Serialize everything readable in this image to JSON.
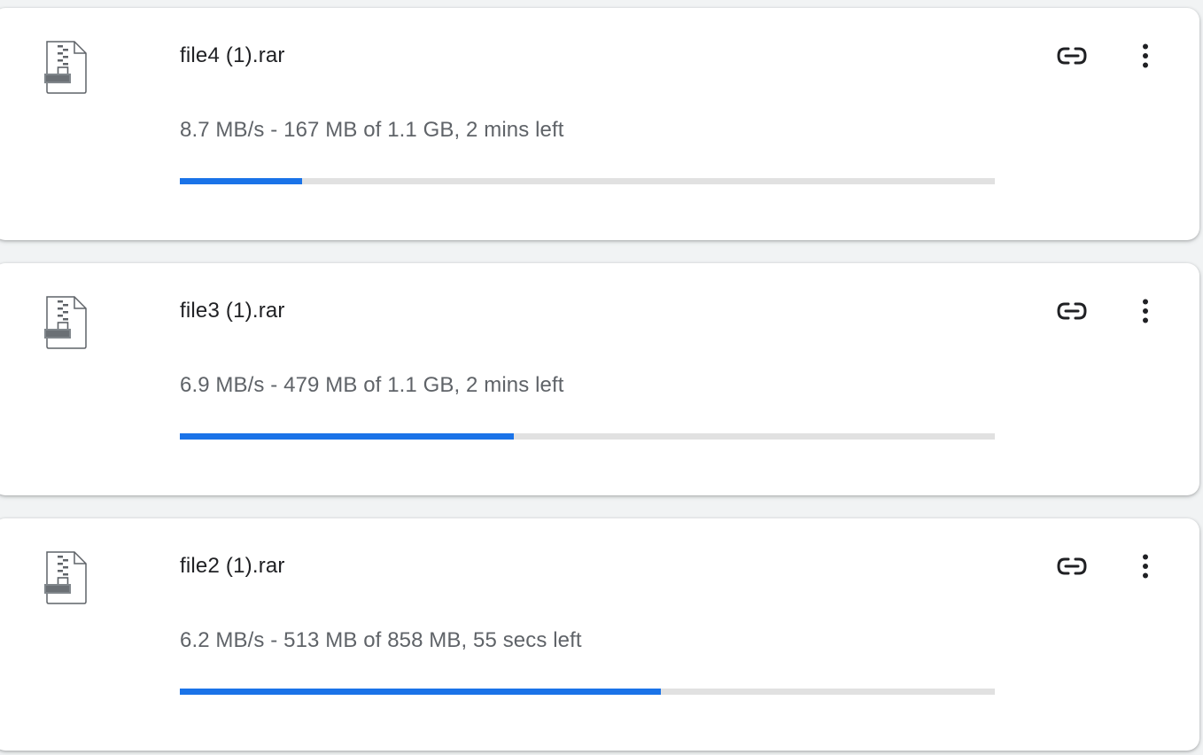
{
  "colors": {
    "accent": "#1a73e8",
    "track": "#e1e1e1",
    "title_text": "#202124",
    "secondary_text": "#5f6368",
    "icon": "#202124"
  },
  "downloads": [
    {
      "file_name": "file4 (1).rar",
      "status": "8.7 MB/s - 167 MB of 1.1 GB, 2 mins left",
      "progress_percent": 15,
      "file_icon": "zip-archive-icon",
      "actions": [
        "copy-link-icon",
        "more-vert-icon"
      ]
    },
    {
      "file_name": "file3 (1).rar",
      "status": "6.9 MB/s - 479 MB of 1.1 GB, 2 mins left",
      "progress_percent": 41,
      "file_icon": "zip-archive-icon",
      "actions": [
        "copy-link-icon",
        "more-vert-icon"
      ]
    },
    {
      "file_name": "file2 (1).rar",
      "status": "6.2 MB/s - 513 MB of 858 MB, 55 secs left",
      "progress_percent": 59,
      "file_icon": "zip-archive-icon",
      "actions": [
        "copy-link-icon",
        "more-vert-icon"
      ]
    }
  ]
}
